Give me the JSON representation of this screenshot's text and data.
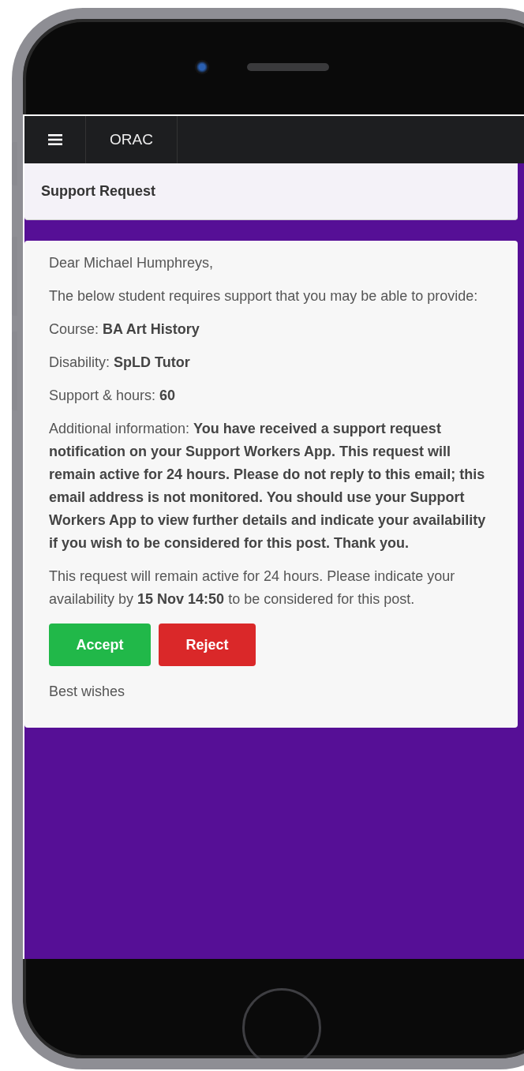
{
  "navbar": {
    "brand": "ORAC"
  },
  "header": {
    "title": "Support Request"
  },
  "message": {
    "paragraphs": [
      "Dear Michael Humphreys,",
      "The below student requires support that you may be able to provide:",
      "Course: **BA Art History**",
      "Disability: **SpLD Tutor**",
      "Support & hours: **60**",
      "Additional information: **You have received a support request notification on your Support Workers App.  This request will remain active for 24 hours. Please do not reply to this email; this email address is not monitored. You should use your Support Workers App to view further details and indicate your availability if you wish to be considered for this post.  Thank you.**",
      "This request will remain active for 24 hours. Please indicate your availability by **15 Nov 14:50** to be considered for this post."
    ],
    "buttons": [
      {
        "label": "Accept",
        "kind": "accept"
      },
      {
        "label": "Reject",
        "kind": "reject"
      }
    ],
    "closing": "Best wishes"
  }
}
